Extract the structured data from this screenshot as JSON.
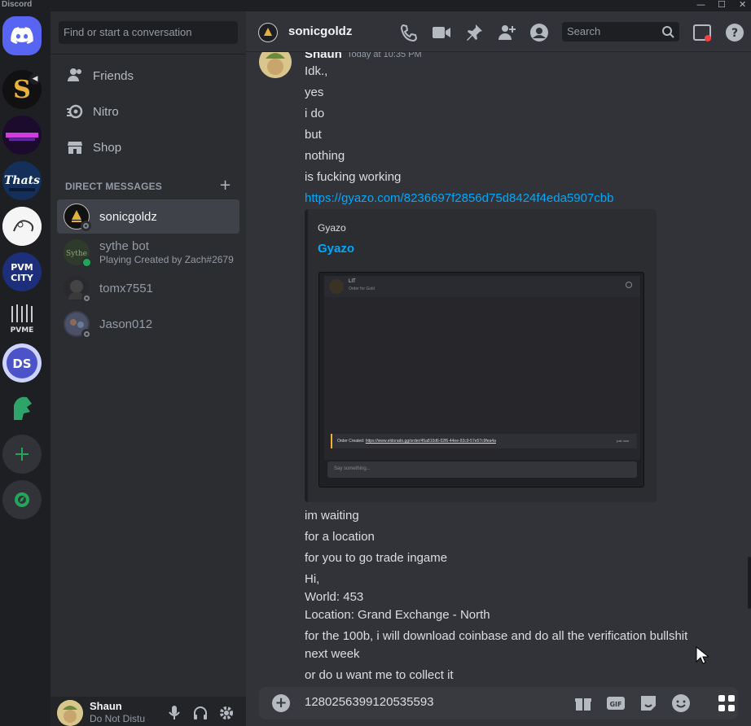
{
  "window": {
    "app_name": "Discord",
    "controls": [
      "—",
      "☐",
      "✕"
    ]
  },
  "rail": {
    "servers": [
      "home",
      "S",
      "neon",
      "Thats",
      "sketch",
      "PVM CITY",
      "PVME",
      "DS",
      "knight"
    ],
    "add_icon": "plus-icon",
    "explore_icon": "compass-icon"
  },
  "sidebar": {
    "search_placeholder": "Find or start a conversation",
    "nav": [
      {
        "label": "Friends",
        "icon": "friends-icon"
      },
      {
        "label": "Nitro",
        "icon": "nitro-icon"
      },
      {
        "label": "Shop",
        "icon": "shop-icon"
      }
    ],
    "dm_header": "DIRECT MESSAGES",
    "dm_add": "+",
    "dms": [
      {
        "name": "sonicgoldz",
        "sub": "",
        "status": "offline",
        "active": true
      },
      {
        "name": "sythe bot",
        "sub": "Playing Created by Zach#2679",
        "status": "online",
        "active": false
      },
      {
        "name": "tomx7551",
        "sub": "",
        "status": "offline",
        "active": false
      },
      {
        "name": "Jason012",
        "sub": "",
        "status": "offline",
        "active": false
      }
    ]
  },
  "user": {
    "name": "Shaun",
    "status": "Do Not Distu"
  },
  "header": {
    "channel_name": "sonicgoldz",
    "search_placeholder": "Search",
    "icons": [
      "call-icon",
      "video-icon",
      "pin-icon",
      "add-friend-icon",
      "profile-icon",
      "inbox-icon",
      "help-icon"
    ]
  },
  "message": {
    "author": "Shaun",
    "timestamp": "Today at 10:35 PM",
    "lines_top": [
      "Idk.,",
      "yes",
      "i do",
      "but",
      "nothing",
      "is fucking working"
    ],
    "link": "https://gyazo.com/8236697f2856d75d8424f4eda5907cbb",
    "embed": {
      "provider": "Gyazo",
      "title": "Gyazo",
      "screenshot": {
        "name": "LIT",
        "subtitle": "Order for Gold",
        "order_label": "Order Created:",
        "order_link": "https://www.eldorado.gg/order/45a810d6-02f6-44ee-92c9-57e57c9fea4a",
        "order_time": "just now",
        "say_placeholder": "Say something..."
      }
    },
    "lines_bottom": [
      "im waiting",
      "for a location",
      "for you to go trade ingame",
      "Hi,",
      "World: 453",
      "Location: Grand Exchange - North",
      "for the 100b, i will download coinbase and do all the verification bullshit",
      "next week",
      "or do u want me to collect it"
    ]
  },
  "composer": {
    "text": "1280256399120535593",
    "icons": [
      "gift-icon",
      "gif-icon",
      "sticker-icon",
      "emoji-icon"
    ]
  },
  "colors": {
    "blurple": "#5865f2",
    "link": "#00a8fc",
    "online": "#23a55a",
    "bg_main": "#313338",
    "bg_sidebar": "#2b2d31",
    "bg_rail": "#1e1f22"
  }
}
